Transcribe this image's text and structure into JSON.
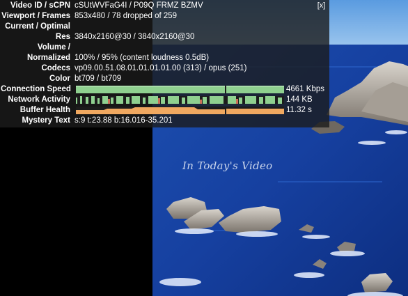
{
  "overlay_text": "In Today's Video",
  "close_label": "[x]",
  "stats": [
    {
      "label": "Video ID / sCPN",
      "value": "cSUtWVFaG4I / P09Q FRMZ BZMV"
    },
    {
      "label": "Viewport / Frames",
      "value": "853x480 / 78 dropped of 259"
    },
    {
      "label": "Current / Optimal",
      "value": ""
    },
    {
      "label": "Res",
      "value": "3840x2160@30 / 3840x2160@30"
    },
    {
      "label": "Volume /",
      "value": ""
    },
    {
      "label": "Normalized",
      "value": "100% / 95% (content loudness 0.5dB)"
    },
    {
      "label": "Codecs",
      "value": "vp09.00.51.08.01.01.01.01.00 (313) / opus (251)"
    },
    {
      "label": "Color",
      "value": "bt709 / bt709"
    }
  ],
  "graphs": [
    {
      "label": "Connection Speed",
      "value": "4661 Kbps",
      "color": "#8fd08f"
    },
    {
      "label": "Network Activity",
      "value": "144 KB",
      "color": "#8fd08f"
    },
    {
      "label": "Buffer Health",
      "value": "11.32 s",
      "color": "#f0a860"
    }
  ],
  "mystery": {
    "label": "Mystery Text",
    "value": "s:9 t:23.88 b:16.016-35.201"
  }
}
